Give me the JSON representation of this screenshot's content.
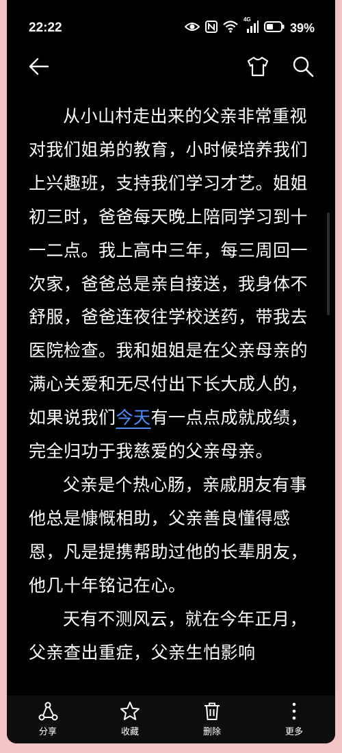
{
  "status_bar": {
    "time": "22:22",
    "network": "4G",
    "battery": "39%"
  },
  "toolbar": {
    "back_icon": "arrow-left-icon",
    "theme_icon": "tshirt-icon",
    "search_icon": "search-icon"
  },
  "article": {
    "paragraphs": [
      {
        "before": "从小山村走出来的父亲非常重视对我们姐弟的教育，小时候培养我们上兴趣班，支持我们学习才艺。姐姐初三时，爸爸每天晚上陪同学习到十一二点。我上高中三年，每三周回一次家，爸爸总是亲自接送，我身体不舒服，爸爸连夜往学校送药，带我去医院检查。我和姐姐是在父亲母亲的满心关爱和无尽付出下长大成人的，如果说我们",
        "link": "今天",
        "after": "有一点点成就成绩，完全归功于我慈爱的父亲母亲。"
      },
      {
        "text": "父亲是个热心肠，亲戚朋友有事他总是慷慨相助，父亲善良懂得感恩，凡是提携帮助过他的长辈朋友，他几十年铭记在心。"
      },
      {
        "text": "天有不测风云，就在今年正月，父亲查出重症，父亲生怕影响"
      }
    ]
  },
  "bottom_bar": {
    "share": "分享",
    "favorite": "收藏",
    "delete": "删除",
    "more": "更多"
  },
  "colors": {
    "background": "#000000",
    "frame": "#f2c4c4",
    "link": "#4f8dff"
  }
}
